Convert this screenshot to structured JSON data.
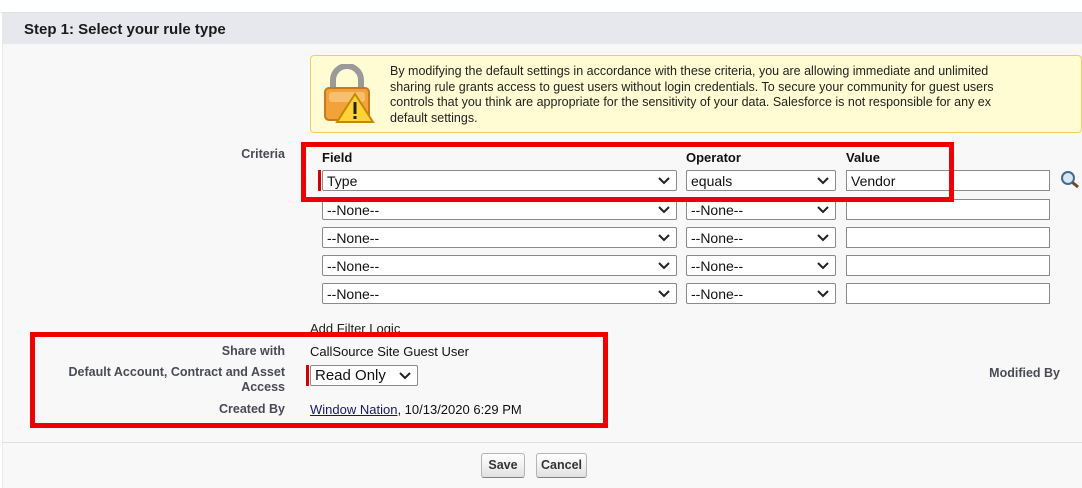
{
  "section": {
    "title": "Step 1: Select your rule type"
  },
  "warning": {
    "lines": [
      "By modifying the default settings in accordance with these criteria, you are allowing immediate and unlimited",
      "sharing rule grants access to guest users without login credentials. To secure your community for guest users",
      "controls that you think are appropriate for the sensitivity of your data. Salesforce is not responsible for any ex",
      "default settings."
    ],
    "icon": "lock-warning-icon"
  },
  "criteria": {
    "label": "Criteria",
    "headers": {
      "field": "Field",
      "operator": "Operator",
      "value": "Value"
    },
    "rows": [
      {
        "field": "Type",
        "operator": "equals",
        "value": "Vendor"
      },
      {
        "field": "--None--",
        "operator": "--None--",
        "value": ""
      },
      {
        "field": "--None--",
        "operator": "--None--",
        "value": ""
      },
      {
        "field": "--None--",
        "operator": "--None--",
        "value": ""
      },
      {
        "field": "--None--",
        "operator": "--None--",
        "value": ""
      }
    ],
    "add_filter_logic": "Add Filter Logic"
  },
  "details": {
    "share_with_label": "Share with",
    "share_with_value": "CallSource Site Guest User",
    "access_label_line1": "Default Account, Contract and Asset",
    "access_label_line2": "Access",
    "access_value": "Read Only",
    "created_by_label": "Created By",
    "created_by_name": "Window Nation",
    "created_by_date": ", 10/13/2020 6:29 PM",
    "modified_by_label": "Modified By"
  },
  "buttons": {
    "save": "Save",
    "cancel": "Cancel"
  },
  "colors": {
    "highlight": "#ee0000",
    "required": "#cc0000",
    "warning_bg": "#fffbd2"
  }
}
